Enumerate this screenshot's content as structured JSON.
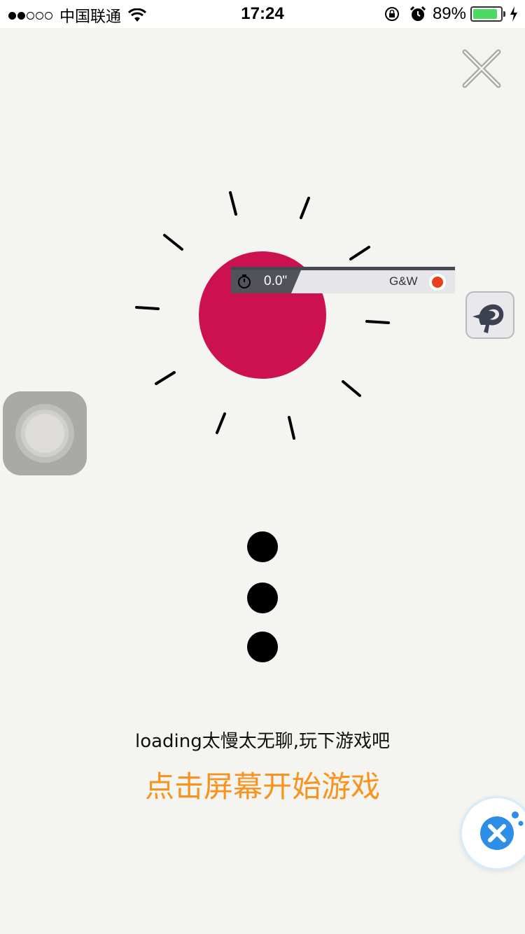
{
  "status_bar": {
    "carrier": "中国联通",
    "time": "17:24",
    "battery_percent": "89%",
    "battery_level": 0.89,
    "signal_bars_filled": 2,
    "signal_bars_total": 5
  },
  "recorder": {
    "time": "0.0\"",
    "tag": "G&W"
  },
  "game": {
    "hint": "loading太慢太无聊,玩下游戏吧",
    "cta": "点击屏幕开始游戏"
  },
  "colors": {
    "sun": "#cd1150",
    "cta": "#f7931e",
    "record": "#e8401c",
    "battery": "#4cd964"
  },
  "icons": {
    "close": "close-icon",
    "timer": "stopwatch-icon",
    "bird_app": "bird-app-icon",
    "assistive": "assistive-touch-icon",
    "tool": "tool-icon"
  }
}
